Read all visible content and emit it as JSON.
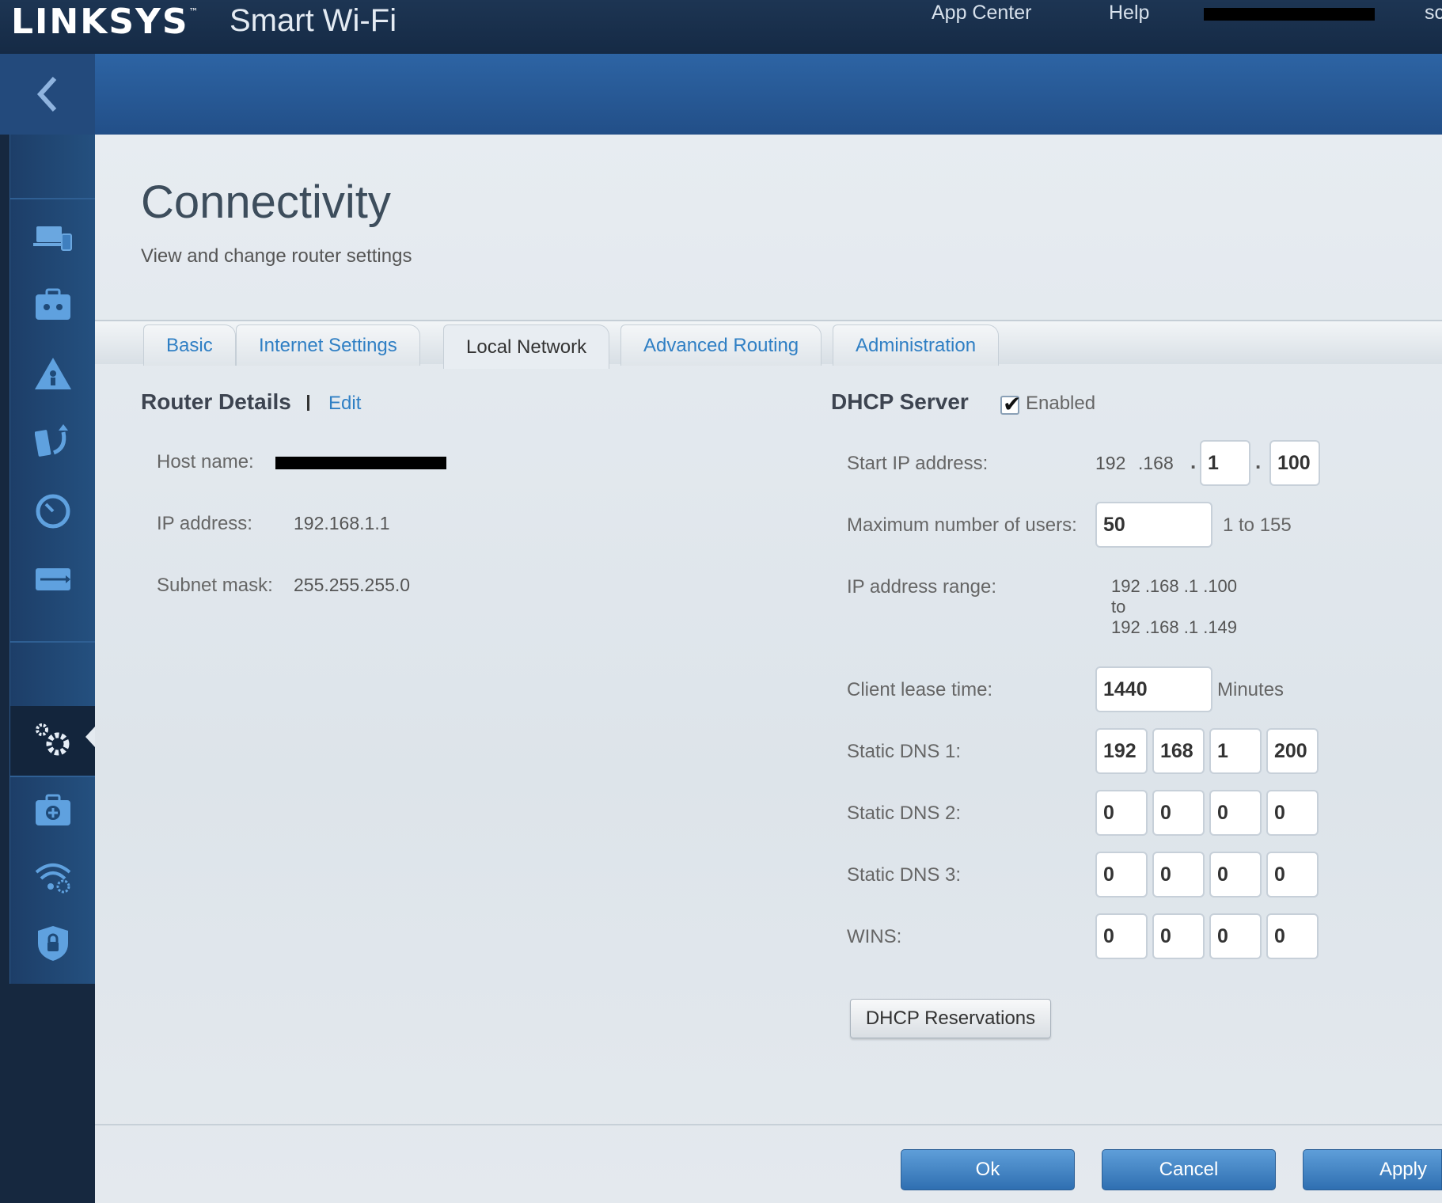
{
  "header": {
    "brand": "LINKSYS",
    "trademark": "™",
    "product": "Smart Wi-Fi",
    "app_center": "App Center",
    "help": "Help",
    "user_partial": "sc"
  },
  "sidebar": {
    "icons": [
      "devices-icon",
      "guest-access-icon",
      "parental-controls-icon",
      "media-prioritization-icon",
      "speed-test-icon",
      "usb-storage-icon",
      "connectivity-settings-icon",
      "troubleshooting-icon",
      "wireless-icon",
      "security-icon"
    ],
    "active": "connectivity-settings-icon"
  },
  "page": {
    "title": "Connectivity",
    "subtitle": "View and change router settings"
  },
  "tabs": [
    {
      "label": "Basic"
    },
    {
      "label": "Internet Settings"
    },
    {
      "label": "Local Network"
    },
    {
      "label": "Advanced Routing"
    },
    {
      "label": "Administration"
    }
  ],
  "active_tab": "Local Network",
  "router_details": {
    "title": "Router Details",
    "edit": "Edit",
    "host_label": "Host name:",
    "ip_label": "IP address:",
    "ip_value": "192.168.1.1",
    "subnet_label": "Subnet mask:",
    "subnet_value": "255.255.255.0"
  },
  "dhcp": {
    "title": "DHCP Server",
    "enabled_label": "Enabled",
    "enabled": true,
    "start_ip_label": "Start IP address:",
    "start_ip_fixed_1": "192",
    "start_ip_fixed_2": ".168",
    "start_ip_3": "1",
    "start_ip_4": "100",
    "max_users_label": "Maximum number of users:",
    "max_users": "50",
    "max_users_hint": "1 to 155",
    "range_label": "IP address range:",
    "range_start": "192 .168 .1 .100",
    "range_to": "to",
    "range_end": "192 .168 .1 .149",
    "lease_label": "Client lease time:",
    "lease_value": "1440",
    "lease_unit": "Minutes",
    "dns1_label": "Static DNS 1:",
    "dns1": [
      "192",
      "168",
      "1",
      "200"
    ],
    "dns2_label": "Static DNS 2:",
    "dns2": [
      "0",
      "0",
      "0",
      "0"
    ],
    "dns3_label": "Static DNS 3:",
    "dns3": [
      "0",
      "0",
      "0",
      "0"
    ],
    "wins_label": "WINS:",
    "wins": [
      "0",
      "0",
      "0",
      "0"
    ],
    "reservations_button": "DHCP Reservations"
  },
  "footer": {
    "ok": "Ok",
    "cancel": "Cancel",
    "apply": "Apply"
  },
  "colors": {
    "topbar": "#16283f",
    "accent_blue": "#2f7fc4",
    "button_blue": "#3d80c2"
  }
}
